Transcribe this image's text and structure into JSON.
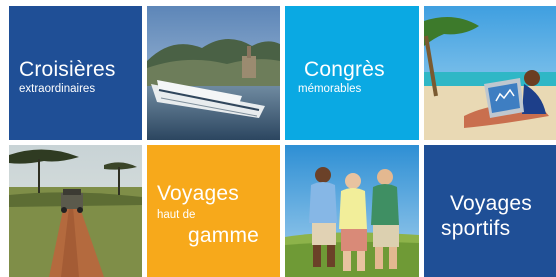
{
  "tiles": {
    "croisieres": {
      "title": "Croisières",
      "subtitle": "extraordinaires",
      "color": "#1f4f96"
    },
    "congres": {
      "title": "Congrès",
      "subtitle": "mémorables",
      "color": "#0aa9e3"
    },
    "voyages_haut": {
      "line1": "Voyages",
      "line2": "haut de",
      "line3": "gamme",
      "color": "#f7a91b"
    },
    "voyages_sportifs": {
      "line1": "Voyages",
      "line2": "sportifs",
      "color": "#1f4f96"
    }
  },
  "photos": {
    "cruise": "river-cruise-photo",
    "beach": "beach-laptop-photo",
    "safari": "safari-jeep-photo",
    "golf": "golf-players-photo"
  }
}
